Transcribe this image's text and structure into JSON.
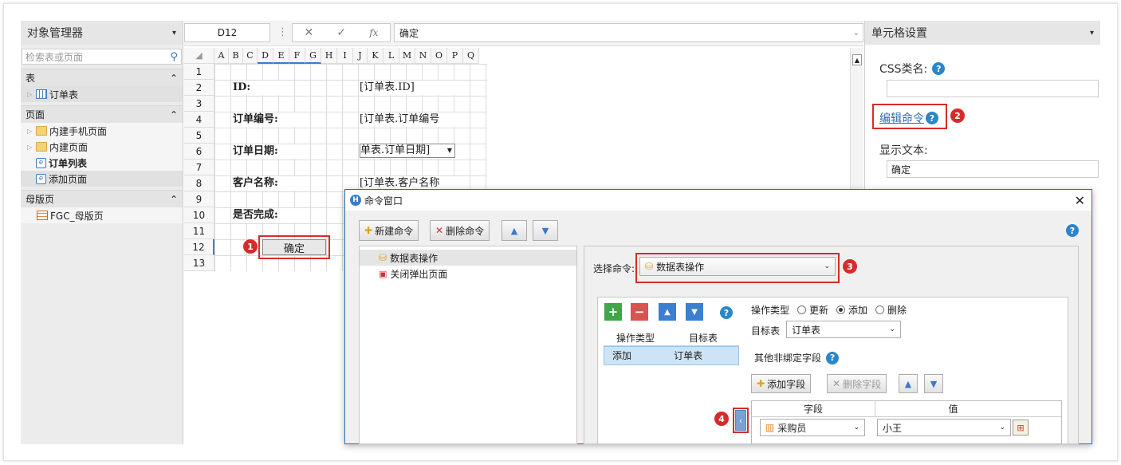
{
  "left_panel": {
    "title": "对象管理器",
    "pin": "📌",
    "search_placeholder": "检索表或页面",
    "sections": [
      {
        "label": "表",
        "items": [
          {
            "label": "订单表",
            "icon": "table-icon"
          }
        ]
      },
      {
        "label": "页面",
        "items": [
          {
            "label": "内建手机页面",
            "icon": "folder-icon"
          },
          {
            "label": "内建页面",
            "icon": "folder-icon"
          },
          {
            "label": "订单列表",
            "icon": "page-icon"
          },
          {
            "label": "添加页面",
            "icon": "page-icon"
          }
        ]
      },
      {
        "label": "母版页",
        "items": [
          {
            "label": "FGC_母版页",
            "icon": "master-icon"
          }
        ]
      }
    ]
  },
  "formula_bar": {
    "cell_ref": "D12",
    "formula": "确定"
  },
  "sheet": {
    "columns": [
      "A",
      "B",
      "C",
      "D",
      "E",
      "F",
      "G",
      "H",
      "I",
      "J",
      "K",
      "L",
      "M",
      "N",
      "O",
      "P",
      "Q"
    ],
    "rows": [
      "1",
      "2",
      "3",
      "4",
      "5",
      "6",
      "7",
      "8",
      "9",
      "10",
      "11",
      "12",
      "13"
    ],
    "labels": [
      "ID:",
      "订单编号:",
      "订单日期:",
      "客户名称:",
      "是否完成:"
    ],
    "fields": [
      "[订单表.ID]",
      "[订单表.订单编号",
      "单表.订单日期]",
      "[订单表.客户名称"
    ],
    "button": "确定"
  },
  "right_panel": {
    "title": "单元格设置",
    "css_label": "CSS类名:",
    "edit_command": "编辑命令",
    "display_text_label": "显示文本:",
    "display_text_value": "确定"
  },
  "dialog": {
    "title": "命令窗口",
    "new_cmd": "新建命令",
    "delete_cmd": "删除命令",
    "commands": [
      "数据表操作",
      "关闭弹出页面"
    ],
    "select_label": "选择命令:",
    "select_value": "数据表操作",
    "op_table_headers": [
      "操作类型",
      "目标表"
    ],
    "op_table_row": [
      "添加",
      "订单表"
    ],
    "op_type_label": "操作类型",
    "op_options": [
      "更新",
      "添加",
      "删除"
    ],
    "target_label": "目标表",
    "target_value": "订单表",
    "unbound_label": "其他非绑定字段",
    "add_field": "添加字段",
    "delete_field": "删除字段",
    "field_headers": [
      "字段",
      "值"
    ],
    "field_row": [
      "采购员",
      "小王"
    ]
  },
  "badges": [
    "1",
    "2",
    "3",
    "4"
  ],
  "colors": {
    "accent": "#2a86c9",
    "highlight": "#d62b2b"
  }
}
